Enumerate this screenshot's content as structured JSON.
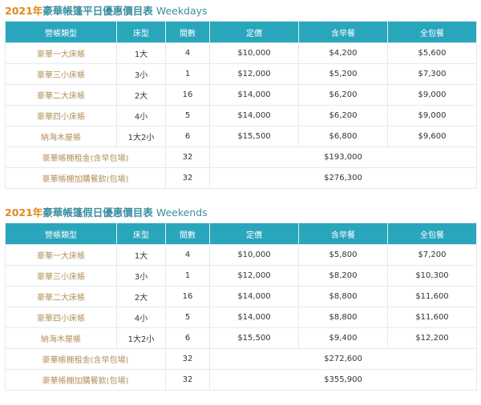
{
  "colors": {
    "accent_year": "#e0891c",
    "accent_title": "#3a8fa1",
    "header_bg": "#2aa6bc",
    "label_gold": "#b1905c"
  },
  "headers": [
    "營帳類型",
    "床型",
    "間數",
    "定價",
    "含早餐",
    "全包餐"
  ],
  "weekdays": {
    "title_year": "2021年",
    "title_cn": "豪華帳篷平日優惠價目表",
    "title_en": "Weekdays",
    "rows": [
      [
        "豪華一大床帳",
        "1大",
        "4",
        "$10,000",
        "$4,200",
        "$5,600"
      ],
      [
        "豪華三小床帳",
        "3小",
        "1",
        "$12,000",
        "$5,200",
        "$7,300"
      ],
      [
        "豪華二大床帳",
        "2大",
        "16",
        "$14,000",
        "$6,200",
        "$9,000"
      ],
      [
        "豪華四小床帳",
        "4小",
        "5",
        "$14,000",
        "$6,200",
        "$9,000"
      ],
      [
        "納海木屋帳",
        "1大2小",
        "6",
        "$15,500",
        "$6,800",
        "$9,600"
      ]
    ],
    "summary": [
      [
        "豪華帳棚租金(含早包場)",
        "32",
        "$193,000"
      ],
      [
        "豪華帳棚加購餐飲(包場)",
        "32",
        "$276,300"
      ]
    ]
  },
  "weekends": {
    "title_year": "2021年",
    "title_cn": "豪華帳篷假日優惠價目表",
    "title_en": "Weekends",
    "rows": [
      [
        "豪華一大床帳",
        "1大",
        "4",
        "$10,000",
        "$5,800",
        "$7,200"
      ],
      [
        "豪華三小床帳",
        "3小",
        "1",
        "$12,000",
        "$8,200",
        "$10,300"
      ],
      [
        "豪華二大床帳",
        "2大",
        "16",
        "$14,000",
        "$8,800",
        "$11,600"
      ],
      [
        "豪華四小床帳",
        "4小",
        "5",
        "$14,000",
        "$8,800",
        "$11,600"
      ],
      [
        "納海木屋帳",
        "1大2小",
        "6",
        "$15,500",
        "$9,400",
        "$12,200"
      ]
    ],
    "summary": [
      [
        "豪華帳棚租金(含早包場)",
        "32",
        "$272,600"
      ],
      [
        "豪華帳棚加購餐飲(包場)",
        "32",
        "$355,900"
      ]
    ]
  }
}
